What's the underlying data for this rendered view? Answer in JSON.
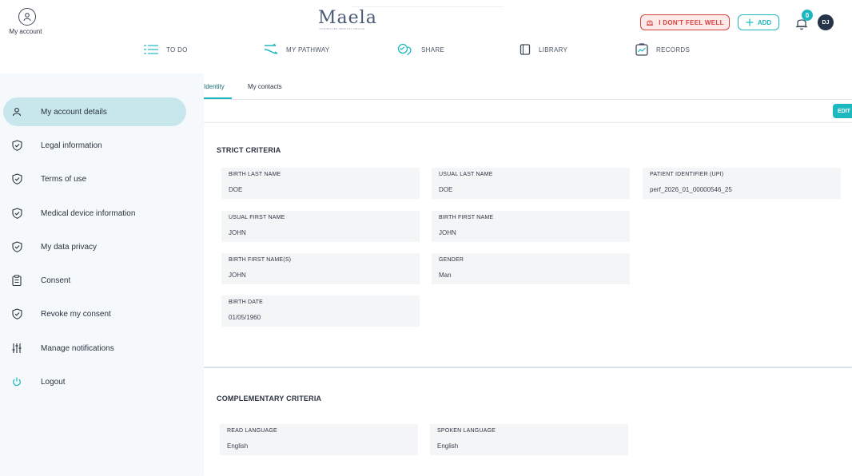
{
  "header": {
    "account_label": "My account",
    "logo_text": "Maela",
    "logo_tagline": "CONNECTED MEDICAL DEVICE",
    "unwell_label": "I DON'T FEEL WELL",
    "add_label": "ADD",
    "notification_count": "0",
    "user_initials": "DJ"
  },
  "nav": {
    "todo": "TO DO",
    "pathway": "MY PATHWAY",
    "share": "SHARE",
    "library": "LIBRARY",
    "records": "RECORDS"
  },
  "sidebar": {
    "items": [
      {
        "label": "My account details",
        "icon": "person-icon"
      },
      {
        "label": "Legal information",
        "icon": "shield-check-icon"
      },
      {
        "label": "Terms of use",
        "icon": "shield-check-icon"
      },
      {
        "label": "Medical device information",
        "icon": "shield-check-icon"
      },
      {
        "label": "My data privacy",
        "icon": "shield-check-icon"
      },
      {
        "label": "Consent",
        "icon": "clipboard-icon"
      },
      {
        "label": "Revoke my consent",
        "icon": "shield-check-icon"
      },
      {
        "label": "Manage notifications",
        "icon": "sliders-icon"
      },
      {
        "label": "Logout",
        "icon": "power-icon"
      }
    ]
  },
  "tabs": {
    "identity": "Identity",
    "contacts": "My contacts"
  },
  "edit_label": "EDIT",
  "strict": {
    "title": "STRICT CRITERIA",
    "birth_last_name": {
      "label": "BIRTH LAST NAME",
      "value": "DOE"
    },
    "usual_last_name": {
      "label": "USUAL LAST NAME",
      "value": "DOE"
    },
    "patient_id": {
      "label": "PATIENT IDENTIFIER (UPI)",
      "value": "perf_2026_01_00000546_25"
    },
    "usual_first_name": {
      "label": "USUAL FIRST NAME",
      "value": "JOHN"
    },
    "birth_first_name": {
      "label": "BIRTH FIRST NAME",
      "value": "JOHN"
    },
    "birth_first_names": {
      "label": "BIRTH FIRST NAME(S)",
      "value": "JOHN"
    },
    "gender": {
      "label": "GENDER",
      "value": "Man"
    },
    "birth_date": {
      "label": "BIRTH DATE",
      "value": "01/05/1960"
    }
  },
  "complementary": {
    "title": "COMPLEMENTARY CRITERIA",
    "read_language": {
      "label": "READ LANGUAGE",
      "value": "English"
    },
    "spoken_language": {
      "label": "SPOKEN LANGUAGE",
      "value": "English"
    }
  },
  "colors": {
    "accent": "#1cb8bf",
    "alert": "#d8423c",
    "sidebar_active": "#c8e7ec",
    "field_bg": "#f4f5f7"
  }
}
